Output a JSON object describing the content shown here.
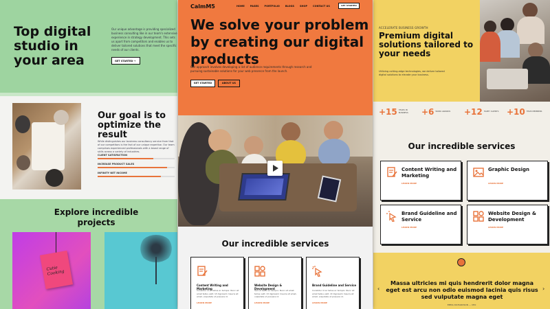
{
  "left": {
    "hero": {
      "title": "Top digital studio in your area",
      "description": "Our unique advantage is providing specialized business consulting like in our team's extensive experience in strategy development. This sets us apart from competitors and enables us to deliver tailored solutions that meet the specific needs of our clients.",
      "cta_label": "GET STARTED →"
    },
    "goal": {
      "title": "Our goal is to optimize the result",
      "description": "While distinguishes our business consultancy service from that of our competitors is the fact of our unique expertise. Our team comprises experienced professionals with a broad range of skills across a variety of industries.",
      "bars": [
        {
          "label": "CLIENT SATISFACTION",
          "value": 0.72
        },
        {
          "label": "INCREASE PRODUCT SALES",
          "value": 0.9
        },
        {
          "label": "INFINITY NET INCOME",
          "value": 0.82
        }
      ]
    },
    "explore": {
      "title": "Explore incredible projects",
      "card1_tag": "Cutie Cooking"
    }
  },
  "center": {
    "logo": "CalmM5",
    "nav": [
      "HOME",
      "PAGES",
      "PORTFOLIO",
      "BLOGS",
      "SHOP",
      "CONTACT US"
    ],
    "nav_cta": "GET STARTED",
    "headline": "We solve your problem by creating our digital products",
    "description": "Our approach involves developing a list of audience requirements through research and pursuing sustainable solutions for your web presence from the launch.",
    "btn_primary": "GET STARTED",
    "btn_secondary": "ABOUT US",
    "services_title": "Our incredible services",
    "cards": [
      {
        "title": "Content Writing and Marketing",
        "desc": "Curabitur id ac tellus ac tempor. Nunc sit amet tellus velit. Ut dignissim mauris sit amet, vulputate ut posuere id.",
        "more": "LEARN MORE",
        "icon": "document-pen-icon"
      },
      {
        "title": "Website Design & Development",
        "desc": "Sed ut tellus ac tempor. Nunc sit amet tellus velit. Ut dignissim mauris sit amet, vulputate ut posuere id.",
        "more": "LEARN MORE",
        "icon": "layout-grid-icon"
      },
      {
        "title": "Brand Guideline and Service",
        "desc": "Curabitur id ac tellus ac tempor. Nunc sit amet tellus velit. Ut dignissim mauris sit amet, vulputate ut posuere id.",
        "more": "LEARN MORE",
        "icon": "cursor-click-icon"
      }
    ]
  },
  "right": {
    "hero": {
      "kicker": "ACCELERATE BUSINESS GROWTH",
      "title": "Premium digital solutions tailored to your needs",
      "description": "Utilizing cutting-edge technologies, we deliver tailored digital solutions to elevate your business."
    },
    "stats": [
      {
        "num": "+15",
        "label": "YEARS IN BUSINESS"
      },
      {
        "num": "+6",
        "label": "WORK AWARDS"
      },
      {
        "num": "+12",
        "label": "HAPPY CLIENTS"
      },
      {
        "num": "+10",
        "label": "TEAM MEMBERS"
      }
    ],
    "services_title": "Our incredible services",
    "cards": [
      {
        "title": "Content Writing and Marketing",
        "more": "LEARN MORE",
        "icon": "document-pen-icon"
      },
      {
        "title": "Graphic Design",
        "more": "LEARN MORE",
        "icon": "image-frame-icon"
      },
      {
        "title": "Brand Guideline and Service",
        "more": "LEARN MORE",
        "icon": "cursor-click-icon"
      },
      {
        "title": "Website Design & Development",
        "more": "LEARN MORE",
        "icon": "layout-grid-icon"
      }
    ],
    "quote": "Massa ultricies mi quis hendrerit dolor magna eget est arcu non odio euismod lacinia quis risus sed vulputate magna eget",
    "author": "EMMA RICHARDSON — CEO"
  },
  "colors": {
    "accent": "#e8733a",
    "center_hero": "#f0793f",
    "left_hero": "#9ed4a0",
    "right_hero": "#f2d262"
  }
}
